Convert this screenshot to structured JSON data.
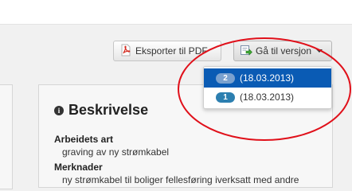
{
  "toolbar": {
    "export_pdf_label": "Eksporter til PDF",
    "goto_version_label": "Gå til versjon"
  },
  "version_menu": {
    "items": [
      {
        "badge": "2",
        "date": "(18.03.2013)",
        "selected": true
      },
      {
        "badge": "1",
        "date": "(18.03.2013)",
        "selected": false
      }
    ]
  },
  "description": {
    "title": "Beskrivelse",
    "work_type_label": "Arbeidets art",
    "work_type_value": "graving av ny strømkabel",
    "remarks_label": "Merknader",
    "remarks_value": "ny strømkabel til boliger fellesføring iverksatt med andre"
  },
  "colors": {
    "selected_bg": "#0a5bb4",
    "annotation_ring": "#e0101a"
  },
  "icons": {
    "pdf": "pdf-file-icon",
    "version": "document-arrow-icon",
    "info": "info-icon",
    "caret": "caret-down-icon"
  }
}
